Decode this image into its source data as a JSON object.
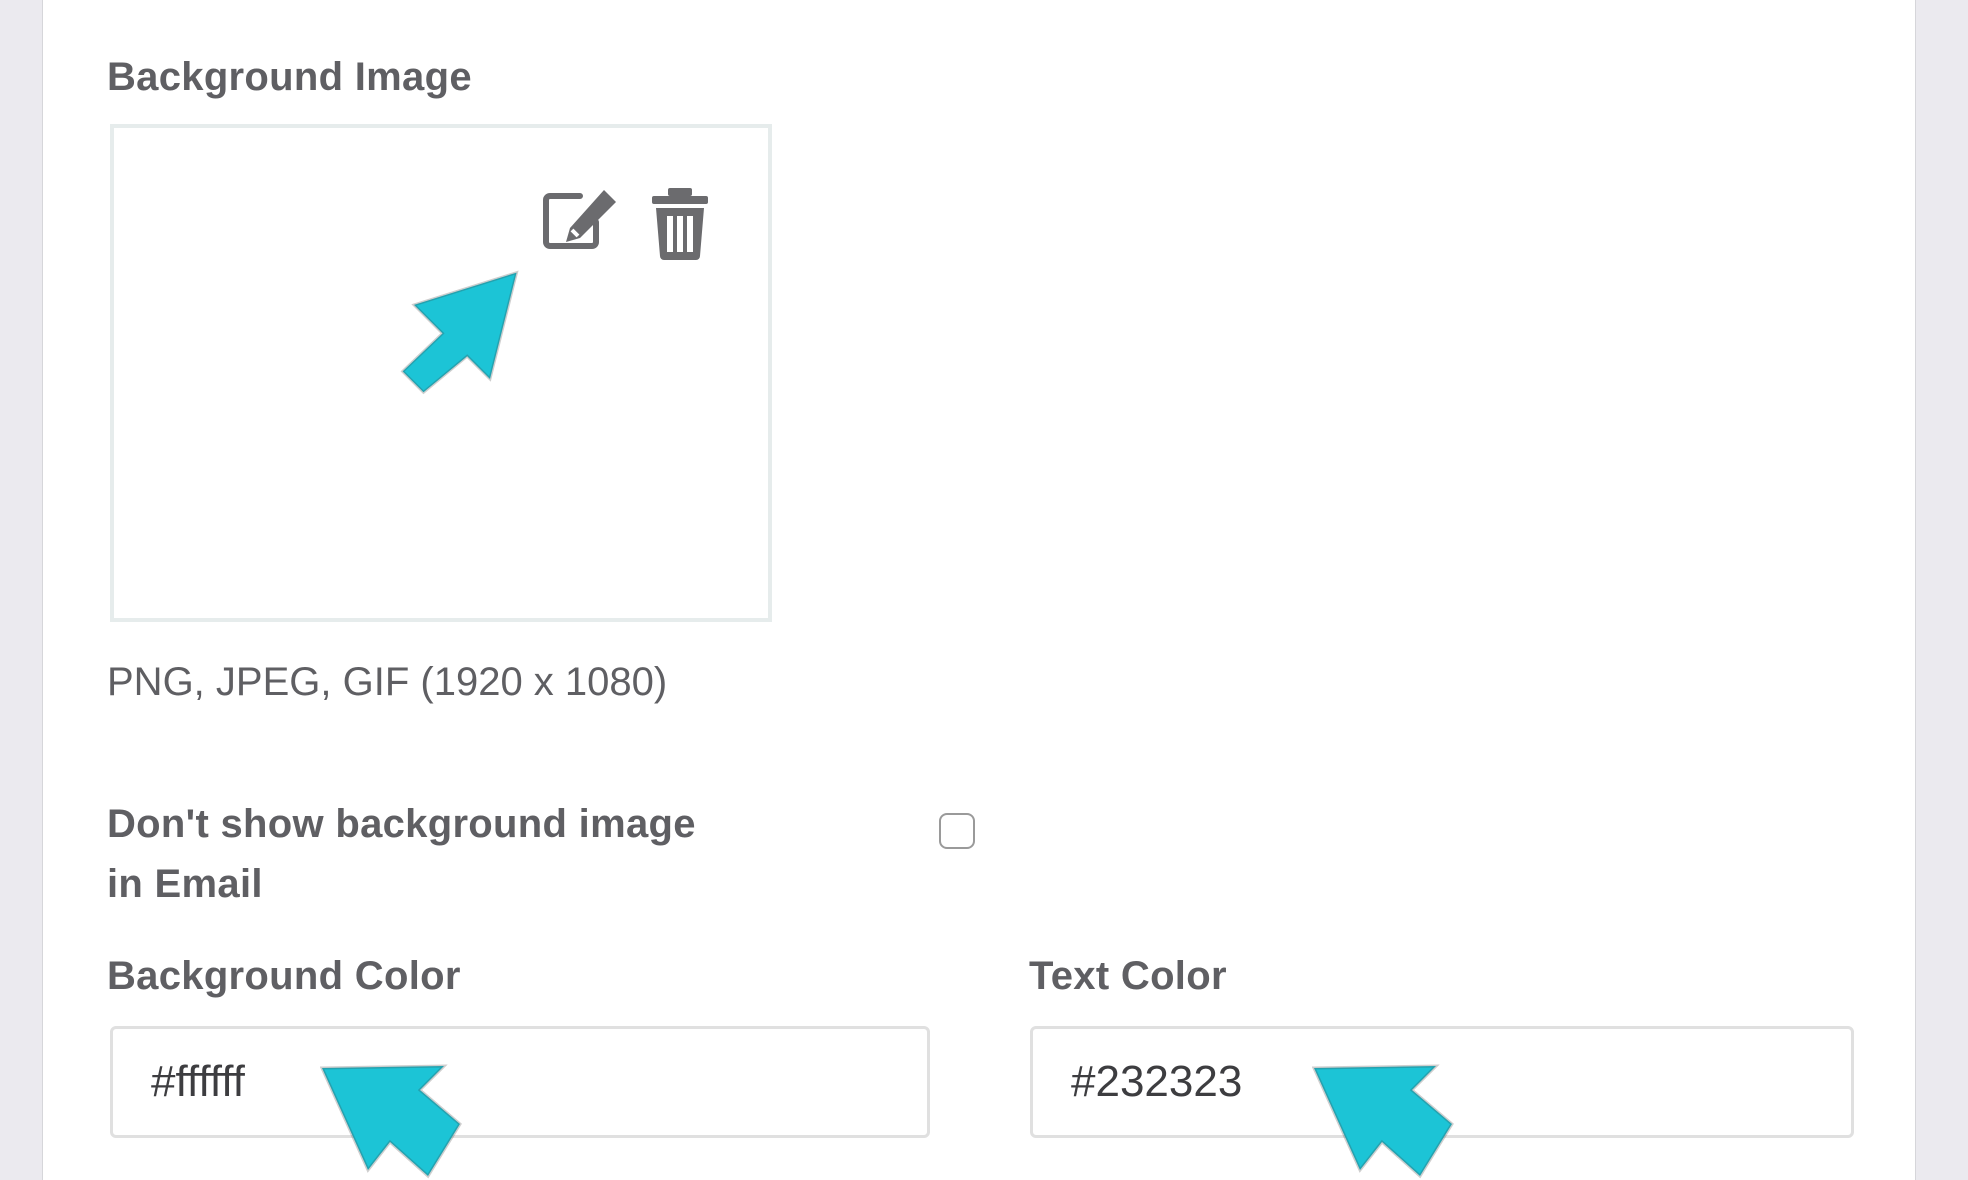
{
  "background_image": {
    "label": "Background Image",
    "hint": "PNG, JPEG, GIF (1920 x 1080)",
    "edit_icon": "edit-icon",
    "delete_icon": "trash-icon"
  },
  "email_option": {
    "label_line1": "Don't show background image",
    "label_line2": "in Email",
    "checked": false
  },
  "background_color": {
    "label": "Background Color",
    "value": "#ffffff"
  },
  "text_color": {
    "label": "Text Color",
    "value": "#232323"
  },
  "annotation_color": "#1cc4d6"
}
